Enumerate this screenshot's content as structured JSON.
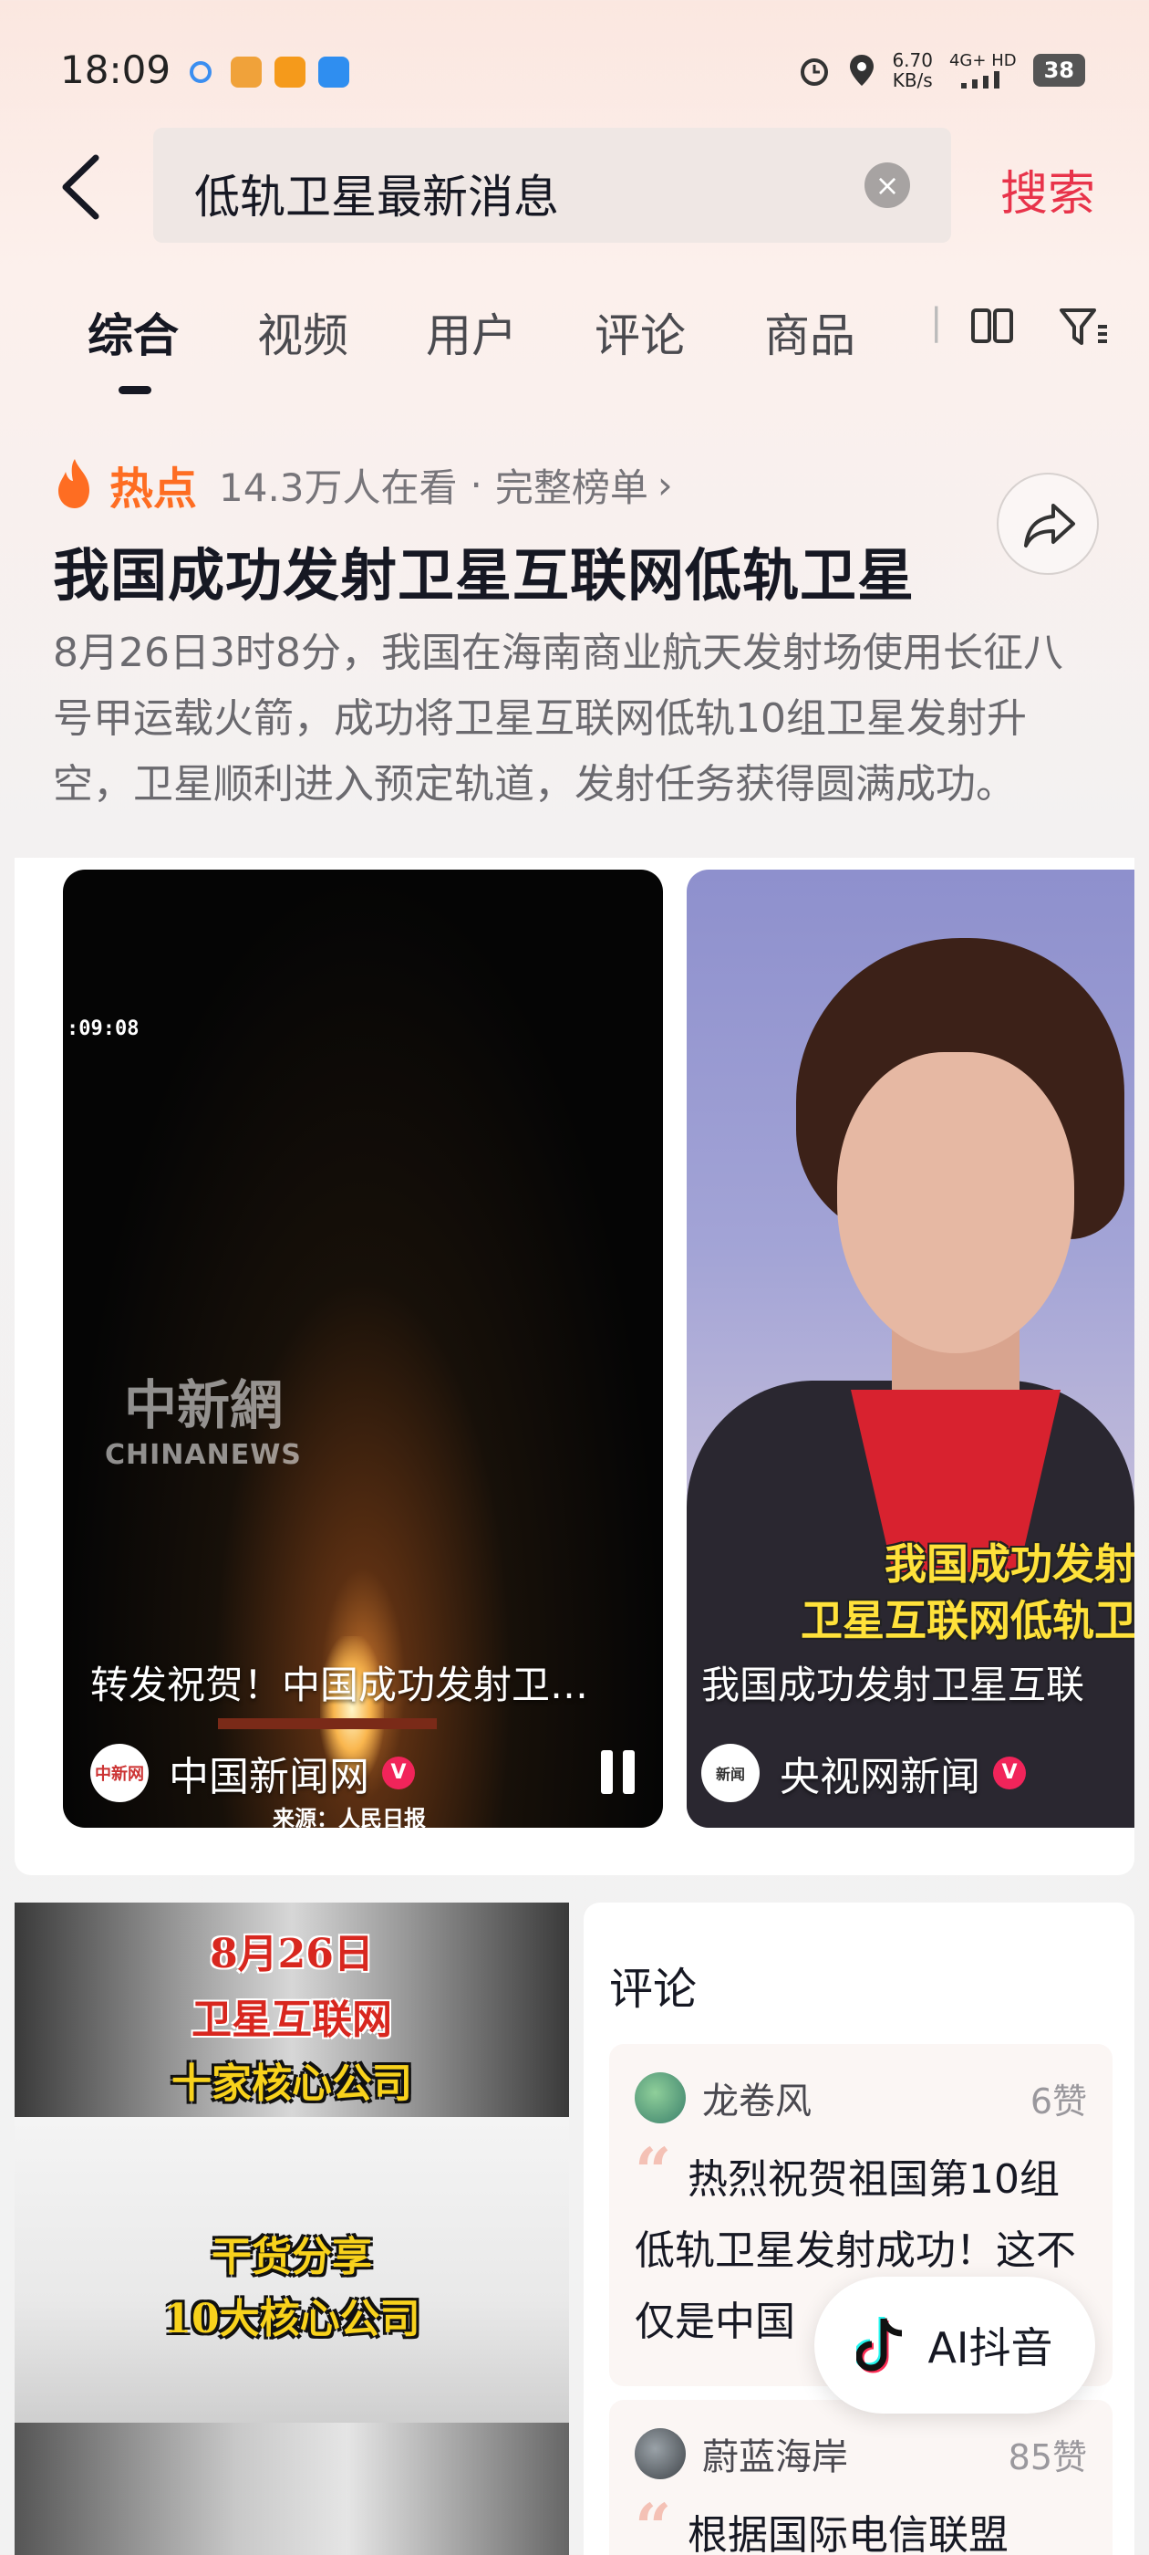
{
  "status_bar": {
    "time": "18:09",
    "net_speed_value": "6.70",
    "net_speed_unit": "KB/s",
    "net_type": "4G+ HD",
    "battery": "38",
    "icons": [
      "message-icon",
      "app-icon",
      "app-icon",
      "app-icon",
      "alarm-icon",
      "location-icon",
      "signal-icon"
    ]
  },
  "search": {
    "query": "低轨卫星最新消息",
    "submit_label": "搜索"
  },
  "tabs": [
    {
      "label": "综合",
      "active": true
    },
    {
      "label": "视频"
    },
    {
      "label": "用户"
    },
    {
      "label": "评论"
    },
    {
      "label": "商品"
    }
  ],
  "hot": {
    "label": "热点",
    "viewers": "14.3万人在看",
    "separator": "·",
    "full_list": "完整榜单",
    "headline": "我国成功发射卫星互联网低轨卫星",
    "summary": "8月26日3时8分，我国在海南商业航天发射场使用长征八号甲运载火箭，成功将卫星互联网低轨10组卫星发射升空，卫星顺利进入预定轨道，发射任务获得圆满成功。"
  },
  "videos": [
    {
      "title": "转发祝贺！中国成功发射卫…",
      "author": "中国新闻网",
      "verified": "V",
      "timestamp": ":09:08",
      "watermark_zh": "中新網",
      "watermark_en": "CHINANEWS",
      "source": "来源：人民日报",
      "avatar_text": "中新网"
    },
    {
      "title": "我国成功发射卫星互联",
      "author": "央视网新闻",
      "verified": "V",
      "caption_line1": "我国成功发射",
      "caption_line2": "卫星互联网低轨卫",
      "avatar_text": "新闻"
    }
  ],
  "poster": {
    "line1": "8月26日",
    "line2": "卫星互联网",
    "line3": "十家核心公司",
    "line4": "干货分享",
    "line5": "10大核心公司"
  },
  "comments": {
    "title": "评论",
    "items": [
      {
        "name": "龙卷风",
        "likes": "6赞",
        "text": "热烈祝贺祖国第10组低轨卫星发射成功！这不仅是中国"
      },
      {
        "name": "蔚蓝海岸",
        "likes": "85赞",
        "text": "根据国际电信联盟"
      }
    ]
  },
  "ai_button": {
    "label": "AI抖音"
  },
  "colors": {
    "accent": "#e8334a",
    "hot": "#fe6d22",
    "verified": "#f1245a"
  }
}
